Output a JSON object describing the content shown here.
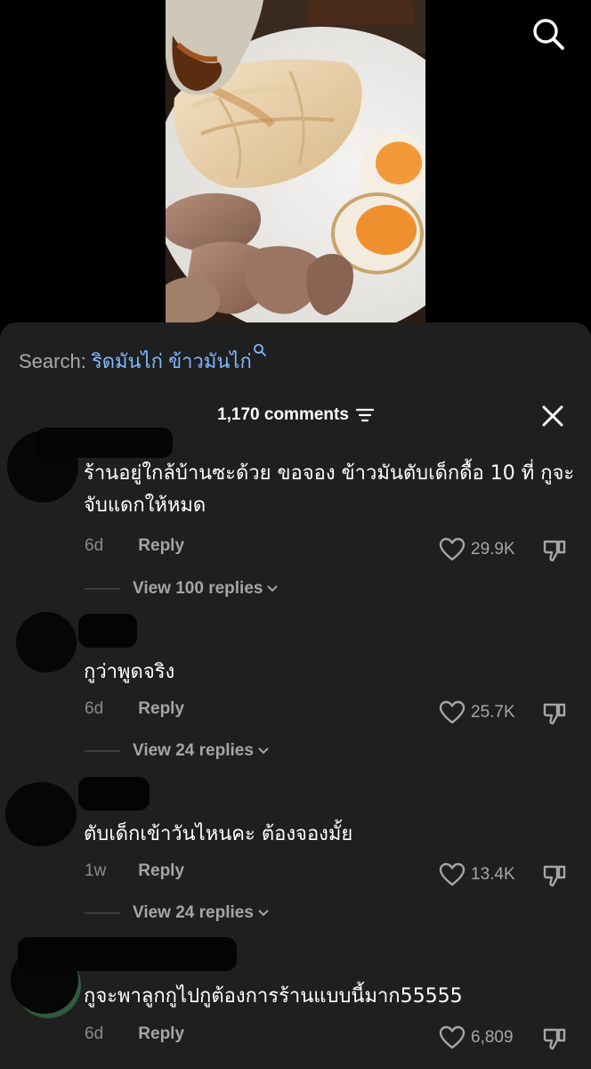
{
  "search": {
    "prefix": "Search:",
    "query": "ริดมันไก่ ข้าวมันไก่"
  },
  "header": {
    "comment_count": "1,170 comments"
  },
  "comments": [
    {
      "text": "ร้านอยู่ใกล้บ้านซะด้วย ขอจอง ข้าวมันตับเด็กดื้อ 10 ที่ กูจะจับแดกให้หมด",
      "time": "6d",
      "reply_label": "Reply",
      "likes": "29.9K",
      "view_replies": "View 100 replies"
    },
    {
      "text": "กูว่าพูดจริง",
      "time": "6d",
      "reply_label": "Reply",
      "likes": "25.7K",
      "view_replies": "View 24 replies"
    },
    {
      "text": "ตับเด็กเข้าวันไหนคะ ต้องจองมั้ย",
      "time": "1w",
      "reply_label": "Reply",
      "likes": "13.4K",
      "view_replies": "View 24 replies"
    },
    {
      "text": "กูจะพาลูกกูไปกูต้องการร้านแบบนี้มาก55555",
      "time": "6d",
      "reply_label": "Reply",
      "likes": "6,809"
    }
  ],
  "icons": {
    "search": "search-icon",
    "sort": "sort-icon",
    "close": "close-icon",
    "heart": "heart-icon",
    "dislike": "thumbs-down-icon",
    "chevron": "chevron-down-icon"
  },
  "colors": {
    "sheet_bg": "#1f1f1f",
    "link": "#7fb8ff",
    "muted": "#a5a5a5"
  }
}
